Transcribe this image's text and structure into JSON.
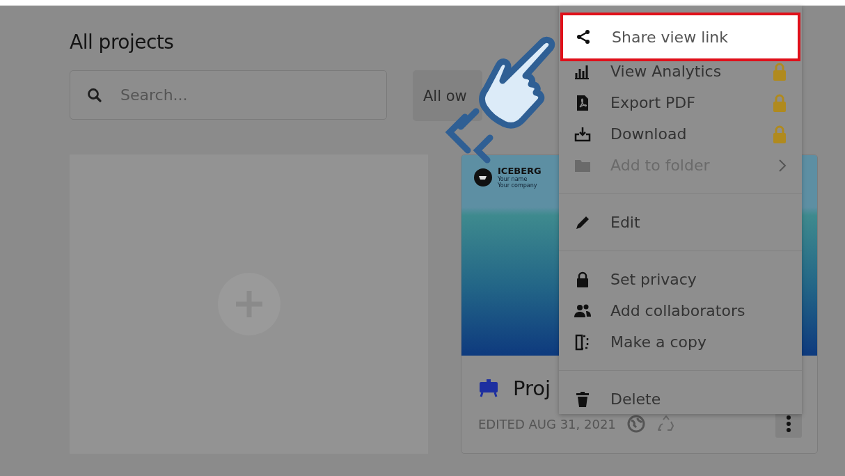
{
  "page_title": "All projects",
  "search": {
    "placeholder": "Search..."
  },
  "owner_filter": {
    "label": "All ow"
  },
  "project_card": {
    "brand": "ICEBERG",
    "brand_lines": [
      "Your name",
      "Your company"
    ],
    "title": "Proj",
    "edited": "EDITED AUG 31, 2021"
  },
  "context_menu": {
    "groups": [
      [
        {
          "kind": "share",
          "label": "Share view link",
          "locked": false,
          "disabled": false,
          "submenu": false,
          "selected": true
        },
        {
          "kind": "analytics",
          "label": "View Analytics",
          "locked": true,
          "disabled": false,
          "submenu": false,
          "selected": false
        },
        {
          "kind": "pdf",
          "label": "Export PDF",
          "locked": true,
          "disabled": false,
          "submenu": false,
          "selected": false
        },
        {
          "kind": "download",
          "label": "Download",
          "locked": true,
          "disabled": false,
          "submenu": false,
          "selected": false
        },
        {
          "kind": "folder",
          "label": "Add to folder",
          "locked": false,
          "disabled": true,
          "submenu": true,
          "selected": false
        }
      ],
      [
        {
          "kind": "edit",
          "label": "Edit",
          "locked": false,
          "disabled": false,
          "submenu": false,
          "selected": false
        }
      ],
      [
        {
          "kind": "privacy",
          "label": "Set privacy",
          "locked": false,
          "disabled": false,
          "submenu": false,
          "selected": false
        },
        {
          "kind": "collaborators",
          "label": "Add collaborators",
          "locked": false,
          "disabled": false,
          "submenu": false,
          "selected": false
        },
        {
          "kind": "copy",
          "label": "Make a copy",
          "locked": false,
          "disabled": false,
          "submenu": false,
          "selected": false
        }
      ],
      [
        {
          "kind": "delete",
          "label": "Delete",
          "locked": false,
          "disabled": false,
          "submenu": false,
          "selected": false
        }
      ]
    ]
  }
}
